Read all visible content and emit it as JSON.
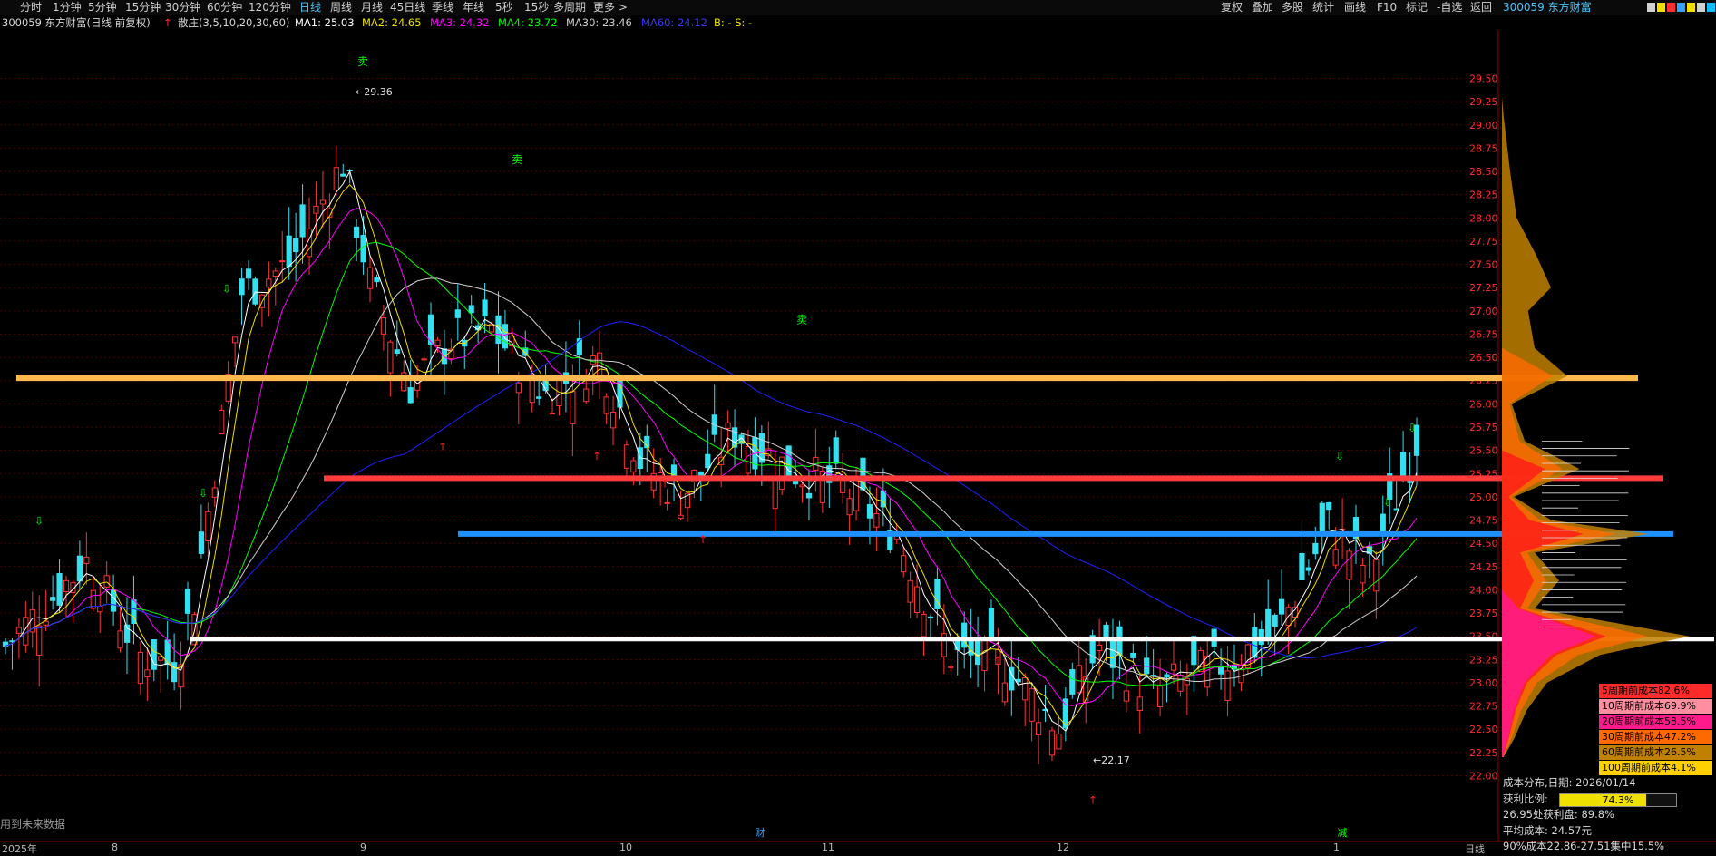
{
  "toolbar": {
    "periods": [
      "分时",
      "1分钟",
      "5分钟",
      "15分钟",
      "30分钟",
      "60分钟",
      "120分钟",
      "日线",
      "周线",
      "月线",
      "45日线",
      "季线",
      "年线",
      "5秒",
      "15秒",
      "多周期",
      "更多 >"
    ],
    "active_period": "日线",
    "right_buttons": [
      "复权",
      "叠加",
      "多股",
      "统计",
      "画线",
      "F10",
      "标记",
      "-自选",
      "返回"
    ]
  },
  "stock": {
    "code": "300059",
    "name": "东方财富",
    "title": "300059 东方财富(日线 前复权)"
  },
  "indicators": {
    "banker": "散庄(3,5,10,20,30,60)",
    "ma1": "MA1: 25.03",
    "ma2": "MA2: 24.65",
    "ma3": "MA3: 24.32",
    "ma4": "MA4: 23.72",
    "ma30": "MA30: 23.46",
    "ma60": "MA60: 24.12",
    "bs": "B: -  S: -"
  },
  "colors": {
    "ma1": "#ffffff",
    "ma2": "#f0e000",
    "ma3": "#ff00ff",
    "ma4": "#00ff00",
    "ma30": "#d0d0d0",
    "ma60": "#2020ff",
    "up": "#ff3333",
    "down": "#33e0f0",
    "orange_line": "#ffb84d",
    "red_line": "#ff3b3b",
    "blue_line": "#1e90ff",
    "white_line": "#ffffff"
  },
  "price_axis": [
    "29.50",
    "29.25",
    "29.00",
    "28.75",
    "28.50",
    "28.25",
    "28.00",
    "27.75",
    "27.50",
    "27.25",
    "27.00",
    "26.75",
    "26.50",
    "26.25",
    "26.00",
    "25.75",
    "25.50",
    "25.25",
    "25.00",
    "24.75",
    "24.50",
    "24.25",
    "24.00",
    "23.75",
    "23.50",
    "23.25",
    "23.00",
    "22.75",
    "22.50",
    "22.25",
    "22.00"
  ],
  "markers": {
    "high": "29.36",
    "low": "22.17",
    "sell": "卖",
    "reduce": "减",
    "finance": "财"
  },
  "time_axis": [
    "2025年",
    "8",
    "9",
    "10",
    "11",
    "12",
    "1",
    "日线"
  ],
  "future_note": "用到未来数据",
  "right_panel": {
    "title": "300059 东方财富",
    "legend": [
      {
        "label": "5周期前成本82.6%",
        "color": "#ff2a2a"
      },
      {
        "label": "10周期前成本69.9%",
        "color": "#ff8fa0"
      },
      {
        "label": "20周期前成本58.5%",
        "color": "#ff1a8c"
      },
      {
        "label": "30周期前成本47.2%",
        "color": "#ff6a00"
      },
      {
        "label": "60周期前成本26.5%",
        "color": "#c08000"
      },
      {
        "label": "100周期前成本4.1%",
        "color": "#ffd000"
      }
    ],
    "cost_title": "成本分布,日期: 2026/01/14",
    "profit_label": "获利比例:",
    "profit_ratio": "74.3%",
    "profit_ratio_fraction": 0.743,
    "profit_at": "26.95处获利盘: 89.8%",
    "avg_cost": "平均成本: 24.57元",
    "concentration": "90%成本22.86-27.51集中15.5%"
  }
}
